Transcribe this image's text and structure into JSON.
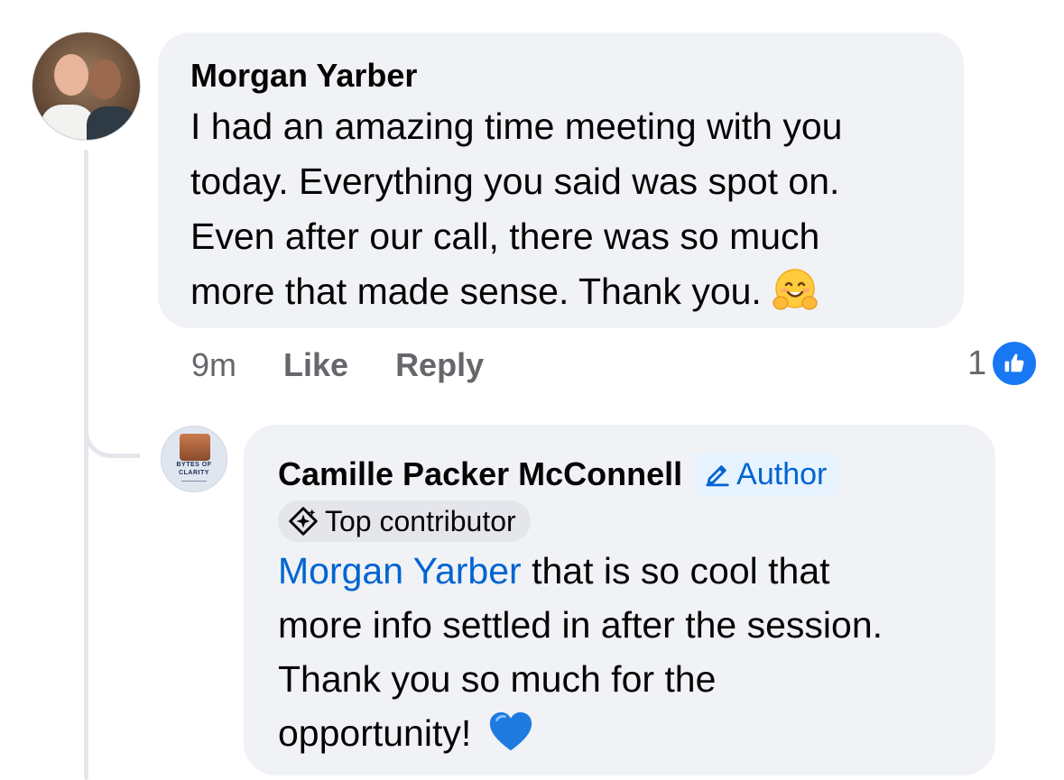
{
  "comment": {
    "author": "Morgan Yarber",
    "lines": [
      "I had an amazing time meeting with you",
      "today.  Everything you said was spot on.",
      "Even after our call, there was so much",
      "more that made sense.  Thank you."
    ],
    "emoji_icon": "smiling-face-with-open-hands-emoji",
    "time": "9m",
    "like_label": "Like",
    "reply_label": "Reply",
    "reaction_count": "1",
    "reaction_icon": "thumbs-up-icon"
  },
  "reply": {
    "author": "Camille Packer McConnell",
    "author_badge": "Author",
    "contributor_badge": "Top contributor",
    "mention": "Morgan Yarber",
    "lines": [
      " that is so cool that",
      "more info settled in after the session.",
      "Thank you so much for the",
      "opportunity!"
    ],
    "emoji_icon": "blue-heart-emoji",
    "avatar_logo_line1": "BYTES OF",
    "avatar_logo_line2": "CLARITY"
  },
  "colors": {
    "bubble": "#f0f2f5",
    "link": "#0064d1",
    "like_blue": "#1877f2",
    "meta_gray": "#65676b"
  }
}
